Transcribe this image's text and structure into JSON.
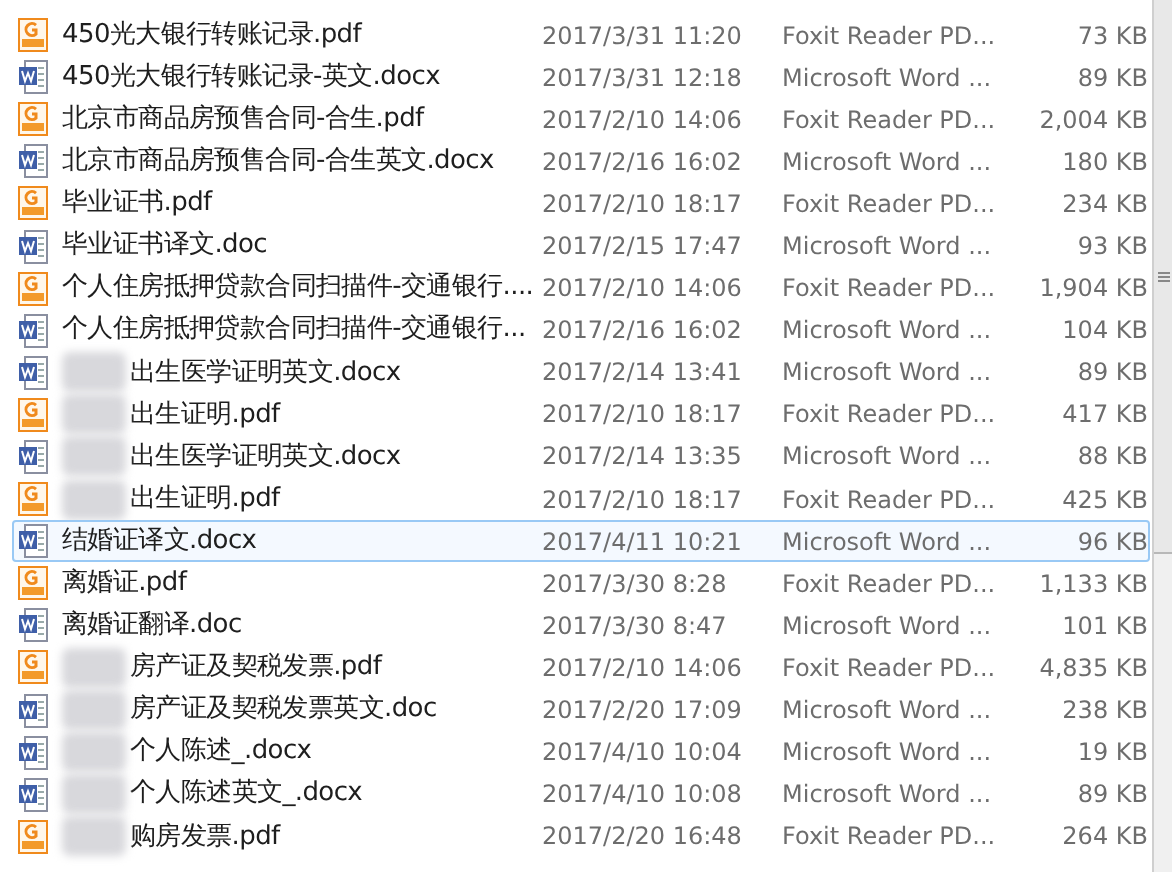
{
  "files": [
    {
      "kind": "pdf",
      "name": "450光大银行转账记录.pdf",
      "date": "2017/3/31 11:20",
      "type": "Foxit Reader PD...",
      "size": "73 KB",
      "selected": false,
      "blurred": false
    },
    {
      "kind": "word",
      "name": "450光大银行转账记录-英文.docx",
      "date": "2017/3/31 12:18",
      "type": "Microsoft Word ...",
      "size": "89 KB",
      "selected": false,
      "blurred": false
    },
    {
      "kind": "pdf",
      "name": "北京市商品房预售合同-合生.pdf",
      "date": "2017/2/10 14:06",
      "type": "Foxit Reader PD...",
      "size": "2,004 KB",
      "selected": false,
      "blurred": false
    },
    {
      "kind": "word",
      "name": "北京市商品房预售合同-合生英文.docx",
      "date": "2017/2/16 16:02",
      "type": "Microsoft Word ...",
      "size": "180 KB",
      "selected": false,
      "blurred": false
    },
    {
      "kind": "pdf",
      "name": "毕业证书.pdf",
      "date": "2017/2/10 18:17",
      "type": "Foxit Reader PD...",
      "size": "234 KB",
      "selected": false,
      "blurred": false
    },
    {
      "kind": "word",
      "name": "毕业证书译文.doc",
      "date": "2017/2/15 17:47",
      "type": "Microsoft Word ...",
      "size": "93 KB",
      "selected": false,
      "blurred": false
    },
    {
      "kind": "pdf",
      "name": "个人住房抵押贷款合同扫描件-交通银行....",
      "date": "2017/2/10 14:06",
      "type": "Foxit Reader PD...",
      "size": "1,904 KB",
      "selected": false,
      "blurred": false
    },
    {
      "kind": "word",
      "name": "个人住房抵押贷款合同扫描件-交通银行...",
      "date": "2017/2/16 16:02",
      "type": "Microsoft Word ...",
      "size": "104 KB",
      "selected": false,
      "blurred": false
    },
    {
      "kind": "word",
      "name": "出生医学证明英文.docx",
      "date": "2017/2/14 13:41",
      "type": "Microsoft Word ...",
      "size": "89 KB",
      "selected": false,
      "blurred": true
    },
    {
      "kind": "pdf",
      "name": "出生证明.pdf",
      "date": "2017/2/10 18:17",
      "type": "Foxit Reader PD...",
      "size": "417 KB",
      "selected": false,
      "blurred": true
    },
    {
      "kind": "word",
      "name": "出生医学证明英文.docx",
      "date": "2017/2/14 13:35",
      "type": "Microsoft Word ...",
      "size": "88 KB",
      "selected": false,
      "blurred": true
    },
    {
      "kind": "pdf",
      "name": "出生证明.pdf",
      "date": "2017/2/10 18:17",
      "type": "Foxit Reader PD...",
      "size": "425 KB",
      "selected": false,
      "blurred": true
    },
    {
      "kind": "word",
      "name": "结婚证译文.docx",
      "date": "2017/4/11 10:21",
      "type": "Microsoft Word ...",
      "size": "96 KB",
      "selected": true,
      "blurred": false
    },
    {
      "kind": "pdf",
      "name": "离婚证.pdf",
      "date": "2017/3/30 8:28",
      "type": "Foxit Reader PD...",
      "size": "1,133 KB",
      "selected": false,
      "blurred": false
    },
    {
      "kind": "word",
      "name": "离婚证翻译.doc",
      "date": "2017/3/30 8:47",
      "type": "Microsoft Word ...",
      "size": "101 KB",
      "selected": false,
      "blurred": false
    },
    {
      "kind": "pdf",
      "name": "房产证及契税发票.pdf",
      "date": "2017/2/10 14:06",
      "type": "Foxit Reader PD...",
      "size": "4,835 KB",
      "selected": false,
      "blurred": true
    },
    {
      "kind": "word",
      "name": "房产证及契税发票英文.doc",
      "date": "2017/2/20 17:09",
      "type": "Microsoft Word ...",
      "size": "238 KB",
      "selected": false,
      "blurred": true
    },
    {
      "kind": "word",
      "name": "个人陈述_.docx",
      "date": "2017/4/10 10:04",
      "type": "Microsoft Word ...",
      "size": "19 KB",
      "selected": false,
      "blurred": true
    },
    {
      "kind": "word",
      "name": "个人陈述英文_.docx",
      "date": "2017/4/10 10:08",
      "type": "Microsoft Word ...",
      "size": "89 KB",
      "selected": false,
      "blurred": true
    },
    {
      "kind": "pdf",
      "name": "购房发票.pdf",
      "date": "2017/2/20 16:48",
      "type": "Foxit Reader PD...",
      "size": "264 KB",
      "selected": false,
      "blurred": true
    }
  ]
}
